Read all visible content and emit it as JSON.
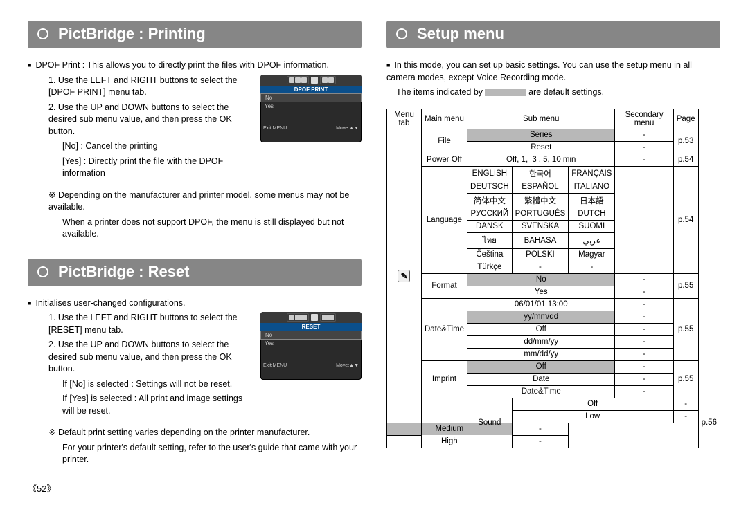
{
  "left": {
    "heading_print": "PictBridge : Printing",
    "print_intro": "DPOF Print : This allows you to directly print the files with DPOF information.",
    "print_step1": "Use the LEFT and RIGHT buttons to select the [DPOF PRINT] menu tab.",
    "print_step2": "Use the UP and DOWN buttons to select the desired sub menu value, and then press the OK button.",
    "print_no": "[No]    : Cancel the printing",
    "print_yes": "[Yes]  : Directly print the file with the DPOF information",
    "print_note1": "Depending on the manufacturer and printer model, some menus may not be available.",
    "print_note2": "When a printer does not support DPOF, the menu is still displayed but not available.",
    "mock_print_title": "DPOF PRINT",
    "mock_no": "No",
    "mock_yes": "Yes",
    "mock_exit": "Exit:MENU",
    "mock_move": "Move:▲▼",
    "heading_reset": "PictBridge : Reset",
    "reset_intro": "Initialises user-changed configurations.",
    "reset_step1": "Use the LEFT and RIGHT buttons to select the [RESET] menu tab.",
    "reset_step2": "Use the UP and DOWN buttons to select the desired sub menu value, and then press the OK button.",
    "reset_no": "If [No] is selected     : Settings will not be reset.",
    "reset_yes": "If [Yes] is selected  : All print and image settings will be reset.",
    "reset_note1": "Default print setting varies depending on the printer manufacturer.",
    "reset_note2": "For your printer's default setting, refer to the user's guide that came with your printer.",
    "mock_reset_title": "RESET",
    "page_number": "《52》"
  },
  "right": {
    "heading": "Setup menu",
    "intro": "In this mode, you can set up basic settings. You can use the setup menu in all camera modes, except Voice Recording mode.",
    "legend_pre": "The items indicated by",
    "legend_post": "are default settings.",
    "th": {
      "menutab": "Menu tab",
      "main": "Main menu",
      "sub": "Sub menu",
      "secondary": "Secondary menu",
      "page": "Page"
    },
    "tab_icon_glyph": "✎",
    "file": {
      "label": "File",
      "series": "Series",
      "reset": "Reset",
      "page": "p.53"
    },
    "poweroff": {
      "label": "Power Off",
      "sub": "Off, 1, 3, 5, 10 min",
      "sub_hl": "3",
      "page": "p.54"
    },
    "language": {
      "label": "Language",
      "rows": [
        [
          "ENGLISH",
          "한국어",
          "FRANÇAIS"
        ],
        [
          "DEUTSCH",
          "ESPAÑOL",
          "ITALIANO"
        ],
        [
          "简体中文",
          "繁體中文",
          "日本語"
        ],
        [
          "РУССКИЙ",
          "PORTUGUÊS",
          "DUTCH"
        ],
        [
          "DANSK",
          "SVENSKA",
          "SUOMI"
        ],
        [
          "ไทย",
          "BAHASA",
          "عربي"
        ],
        [
          "Čeština",
          "POLSKI",
          "Magyar"
        ],
        [
          "Türkçe",
          "-",
          "-"
        ]
      ],
      "page": "p.54"
    },
    "format": {
      "label": "Format",
      "no": "No",
      "yes": "Yes",
      "page": "p.55"
    },
    "datetime": {
      "label": "Date&Time",
      "rows": [
        "06/01/01 13:00",
        "yy/mm/dd",
        "Off",
        "dd/mm/yy",
        "mm/dd/yy"
      ],
      "hl_index": 1,
      "page": "p.55"
    },
    "imprint": {
      "label": "Imprint",
      "rows": [
        "Off",
        "Date",
        "Date&Time"
      ],
      "hl_index": 0,
      "page": "p.55"
    },
    "sound": {
      "label": "Sound",
      "rows": [
        "Off",
        "Low",
        "Medium",
        "High"
      ],
      "hl_index": 2,
      "page": "p.56"
    }
  }
}
